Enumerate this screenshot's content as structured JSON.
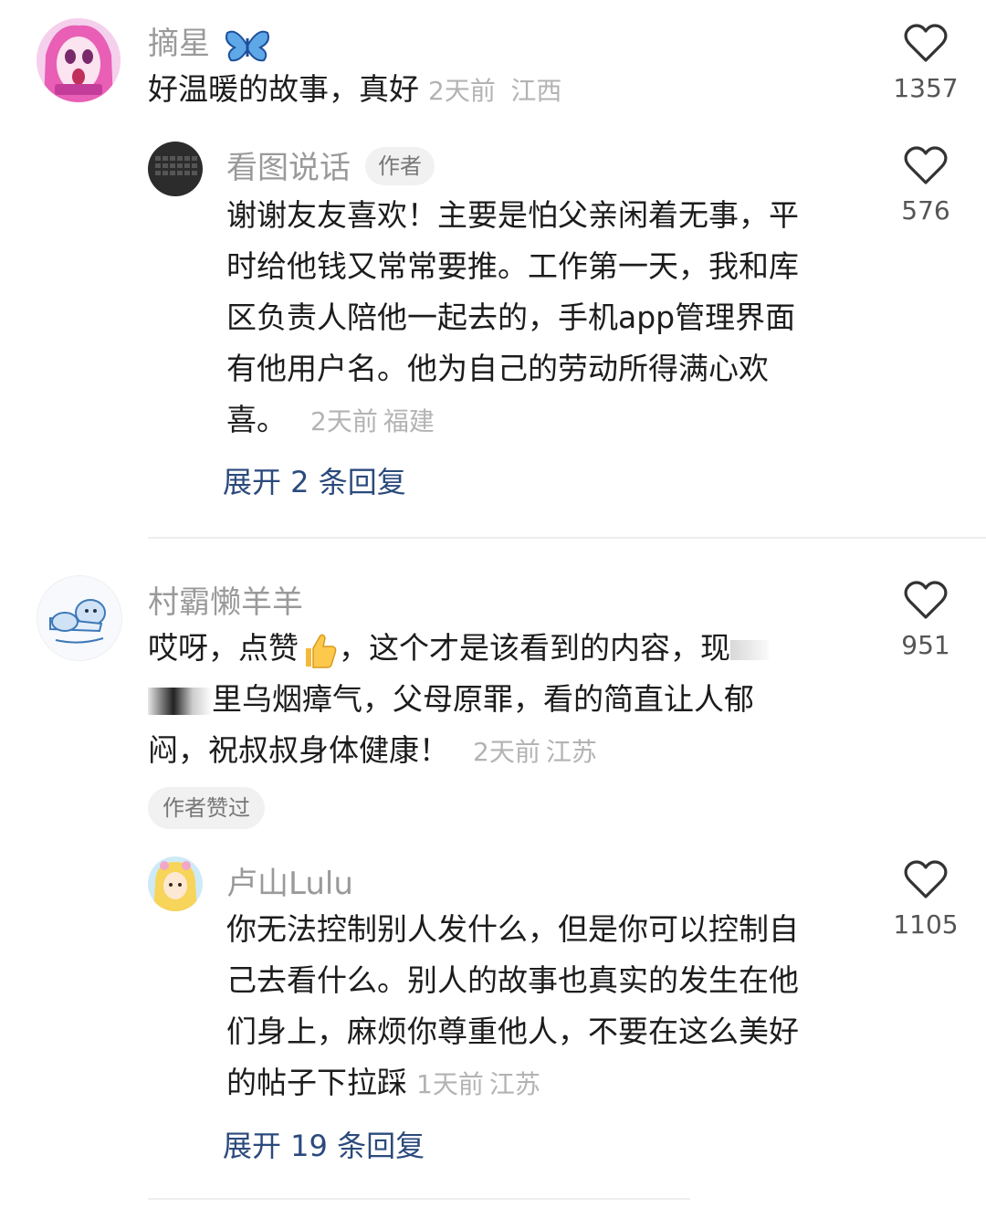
{
  "comments": [
    {
      "username": "摘星",
      "text": "好温暖的故事，真好",
      "time": "2天前",
      "location": "江西",
      "likes": "1357",
      "icons": [
        "butterfly-icon"
      ],
      "replies": [
        {
          "username": "看图说话",
          "badge": "作者",
          "lines": [
            "谢谢友友喜欢！主要是怕父亲闲着无事，平",
            "时给他钱又常常要推。工作第一天，我和库",
            "区负责人陪他一起去的，手机app管理界面",
            "有他用户名。他为自己的劳动所得满心欢",
            "喜。"
          ],
          "time": "2天前",
          "location": "福建",
          "likes": "576"
        }
      ],
      "expand_label": "展开 2 条回复"
    },
    {
      "username": "村霸懒羊羊",
      "lines": [
        "哎呀，点赞",
        "，这个才是该看到的内容，现",
        "里乌烟瘴气，父母原罪，看的简直让人郁",
        "闷，祝叔叔身体健康！"
      ],
      "time": "2天前",
      "location": "江苏",
      "likes": "951",
      "author_liked": "作者赞过",
      "icons": [
        "thumbs-up-emoji-icon"
      ],
      "replies": [
        {
          "username": "卢山Lulu",
          "lines": [
            "你无法控制别人发什么，但是你可以控制自",
            "己去看什么。别人的故事也真实的发生在他",
            "们身上，麻烦你尊重他人，不要在这么美好",
            "的帖子下拉踩"
          ],
          "time": "1天前",
          "location": "江苏",
          "likes": "1105"
        }
      ],
      "expand_label": "展开 19 条回复"
    }
  ],
  "colors": {
    "username": "#9a9a9a",
    "text": "#1c1c1c",
    "meta": "#b3b3b3",
    "expand": "#2b4a7c",
    "divider": "#eeeeee"
  }
}
